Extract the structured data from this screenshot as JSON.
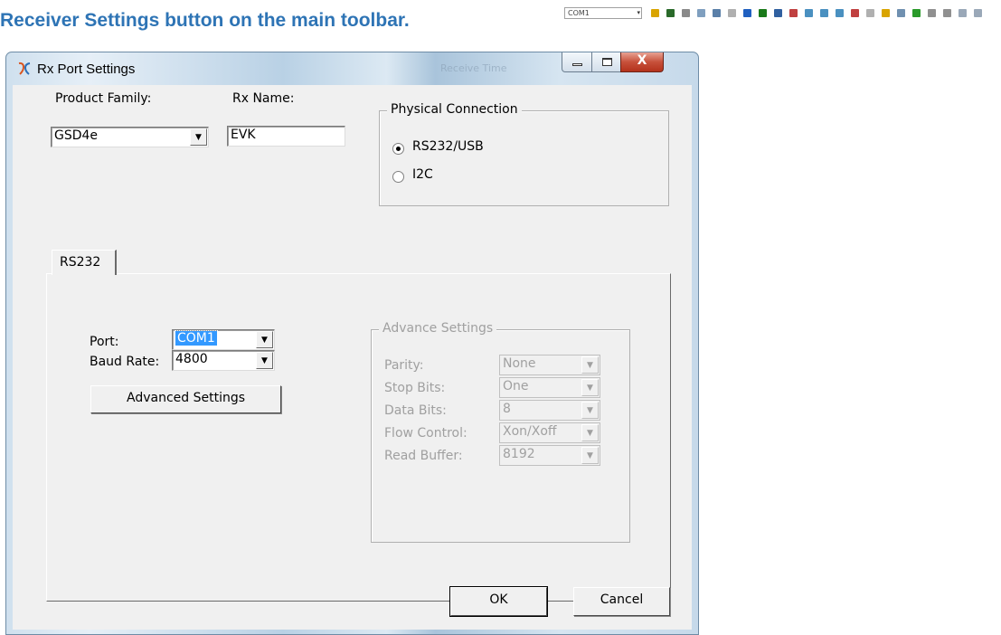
{
  "document": {
    "heading": "Receiver Settings button on the main toolbar."
  },
  "mini_toolbar": {
    "combo_value": "COM1",
    "icons": [
      "gear-icon",
      "transfer-icon",
      "pause-icon",
      "chart-icon",
      "save-icon",
      "undo-icon",
      "window-icon",
      "record-icon",
      "grid-icon",
      "location-icon",
      "view-icon",
      "view-icon",
      "view-icon",
      "view-icon",
      "pen-icon",
      "folder-icon",
      "stop-icon",
      "play-icon",
      "pause-icon",
      "stop-icon",
      "window-icon",
      "window-icon"
    ]
  },
  "dialog": {
    "title": "Rx Port Settings",
    "background_title": "Receive Time",
    "title_buttons": {
      "close": "X"
    },
    "product_family": {
      "label": "Product Family:",
      "value": "GSD4e"
    },
    "rx_name": {
      "label": "Rx Name:",
      "value": "EVK"
    },
    "physical_connection": {
      "title": "Physical Connection",
      "options": [
        {
          "label": "RS232/USB",
          "checked": true
        },
        {
          "label": "I2C",
          "checked": false
        }
      ]
    },
    "tab_label": "RS232",
    "port": {
      "label": "Port:",
      "value": "COM1"
    },
    "baud_rate": {
      "label": "Baud Rate:",
      "value": "4800"
    },
    "advanced_button": "Advanced Settings",
    "advance_settings": {
      "title": "Advance Settings",
      "rows": [
        {
          "label": "Parity:",
          "value": "None"
        },
        {
          "label": "Stop Bits:",
          "value": "One"
        },
        {
          "label": "Data Bits:",
          "value": "8"
        },
        {
          "label": "Flow Control:",
          "value": "Xon/Xoff"
        },
        {
          "label": "Read Buffer:",
          "value": "8192"
        }
      ]
    },
    "ok_button": "OK",
    "cancel_button": "Cancel"
  },
  "colors": {
    "heading": "#2e74b5",
    "selection": "#3399ff",
    "close_button": "#c7513b"
  }
}
